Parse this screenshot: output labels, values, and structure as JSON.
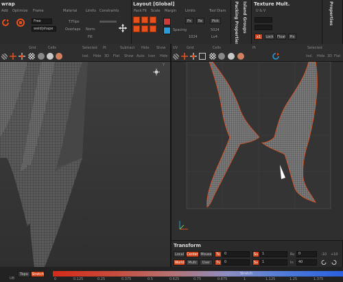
{
  "wrap_panel": {
    "title": "wrap",
    "headers": [
      "Add",
      "Optimize",
      "Frame",
      "Material",
      "Limits",
      "Constraints"
    ],
    "inputs": [
      "weld|shape"
    ],
    "frame_value": "Free",
    "flip_label": "T.Flips",
    "overlaps_label": "Overlaps",
    "norm_label": "Norm",
    "fill_label": "Fill"
  },
  "layout_panel": {
    "title": "Layout [Global]",
    "headers": [
      "Pack",
      "Fit",
      "Scale",
      "Margin",
      "Limits",
      "Tool Diam"
    ],
    "buttons": [
      "Px",
      "Re",
      "Pick"
    ],
    "spacing_label": "Spacing",
    "v1": "5024",
    "v2": "1024",
    "v3": "Lv4"
  },
  "side_tabs": [
    "Packing Properties [",
    "Island Groups"
  ],
  "texture_panel": {
    "title": "Texture Mult.",
    "sub": "U & V",
    "buttons": [
      "x1",
      "Lock",
      "Float",
      "Pix"
    ]
  },
  "properties_tab": "Properties",
  "left_viewport": {
    "toolbar": [
      "Grid",
      "Cells",
      "Selected",
      "Pt",
      "Subtract",
      "Hide",
      "Show"
    ],
    "toolbar2": [
      "Isol.",
      "Hide",
      "3D",
      "Flat",
      "Show",
      "Auto",
      "Icon",
      "Hide"
    ],
    "nav": "Y"
  },
  "right_viewport": {
    "toolbar": [
      "UV",
      "Grid",
      "Cells",
      "Pt",
      "Selected"
    ],
    "toolbar2": [
      "Isol.",
      "Hide",
      "3D",
      "Flat"
    ]
  },
  "transform": {
    "title": "Transform",
    "row1": [
      "Local",
      "Center",
      "Mouse"
    ],
    "row2": [
      "World",
      "Multi",
      "User"
    ],
    "fields_a": [
      "Tu",
      "Su",
      "Ru"
    ],
    "fields_b": [
      "Tv",
      "Sv",
      "In"
    ],
    "val0": "0",
    "val1": "1",
    "val40": "40",
    "far": [
      "-10",
      "+10"
    ]
  },
  "status_bar": {
    "left": [
      "Topo",
      "Stretch"
    ],
    "mid_label": "Stretch",
    "ticks": [
      "0",
      "0.125",
      "0.25",
      "0.375",
      "0.5",
      "0.625",
      "0.75",
      "0.875",
      "1",
      "1.125",
      "1.25",
      "1.375"
    ],
    "corner": "UB"
  },
  "colors": {
    "accent": "#e8501c",
    "bg": "#2b2b2b",
    "viewport": "#3a3a3a"
  }
}
